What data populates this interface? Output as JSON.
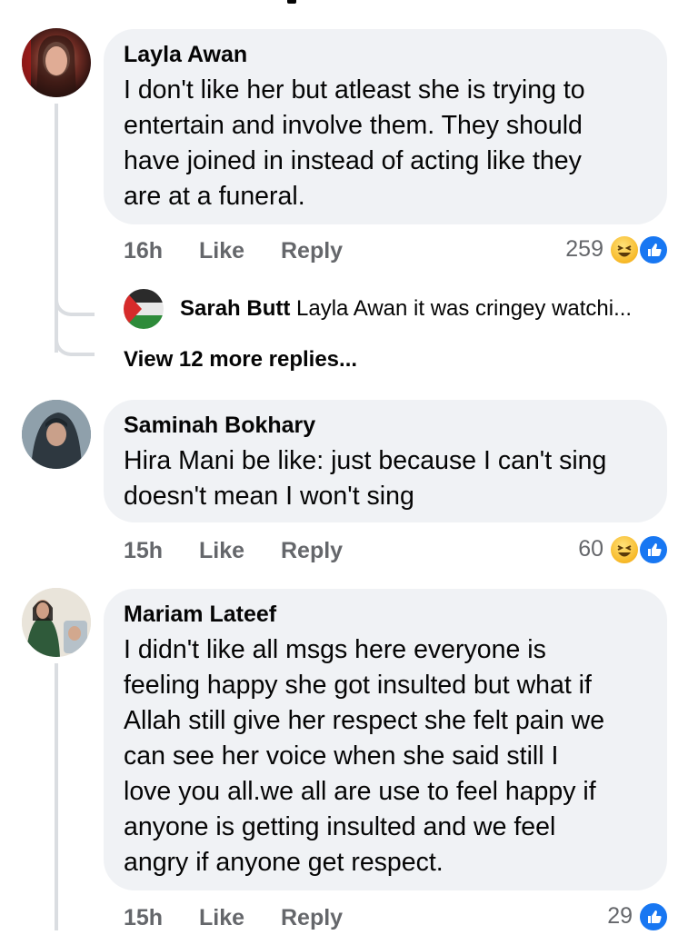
{
  "comments": [
    {
      "author": "Layla Awan",
      "text": "I don't like her but atleast she is trying to\nentertain and involve them. They should\nhave joined in instead of acting like they\nare at a funeral.",
      "time": "16h",
      "like": "Like",
      "reply": "Reply",
      "reaction_count": "259",
      "reactions": [
        "haha-icon",
        "like-icon"
      ]
    },
    {
      "author": "Saminah Bokhary",
      "text": "Hira Mani be like: just because I can't sing\ndoesn't mean I won't sing",
      "time": "15h",
      "like": "Like",
      "reply": "Reply",
      "reaction_count": "60",
      "reactions": [
        "haha-icon",
        "like-icon"
      ]
    },
    {
      "author": "Mariam Lateef",
      "text": "I didn't like all msgs here everyone is\nfeeling happy she got insulted but what if\nAllah still give her respect she felt pain we\ncan see her voice when she said still I\nlove you all.we all are use to feel happy if\nanyone is getting insulted and we feel\nangry if anyone get respect.",
      "time": "15h",
      "like": "Like",
      "reply": "Reply",
      "reaction_count": "29",
      "reactions": [
        "like-icon"
      ]
    }
  ],
  "replies": {
    "author": "Sarah Butt",
    "snippet": "Layla Awan it was cringey watchi...",
    "view_more": "View 12 more replies..."
  },
  "colors": {
    "bubble": "#f0f2f5",
    "meta": "#65676b",
    "like_blue": "#1877f2",
    "haha_yellow": "#f7b928"
  }
}
